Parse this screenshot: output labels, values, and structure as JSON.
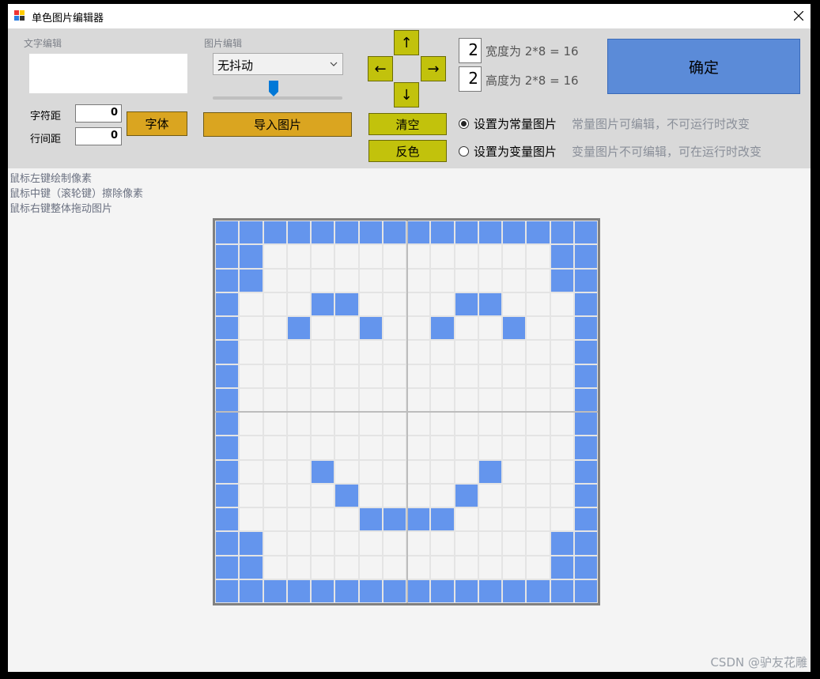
{
  "window": {
    "title": "单色图片编辑器"
  },
  "text_edit": {
    "label": "文字编辑",
    "value": ""
  },
  "char_spacing": {
    "label": "字符距",
    "value": "0"
  },
  "line_spacing": {
    "label": "行间距",
    "value": "0"
  },
  "font_button": "字体",
  "image_edit": {
    "label": "图片编辑",
    "dither_selected": "无抖动",
    "slider_level": 0.47
  },
  "import_button": "导入图片",
  "arrows": {
    "up": "↑",
    "down": "↓",
    "left": "←",
    "right": "→"
  },
  "clear_button": "清空",
  "invert_button": "反色",
  "size": {
    "width_value": "2",
    "width_label": "宽度为 2*8 = 16",
    "height_value": "2",
    "height_label": "高度为 2*8 = 16"
  },
  "confirm_button": "确定",
  "mode": {
    "selected": "constant",
    "constant_label": "设置为常量图片",
    "constant_hint": "常量图片可编辑，不可运行时改变",
    "variable_label": "设置为变量图片",
    "variable_hint": "变量图片不可编辑，可在运行时改变"
  },
  "hints": [
    "鼠标左键绘制像素",
    "鼠标中键（滚轮键）擦除像素",
    "鼠标右键整体拖动图片"
  ],
  "pixel_grid": {
    "size": 16,
    "on_color": "#6495ed",
    "rows": [
      "1111111111111111",
      "1100000000000011",
      "1100000000000011",
      "1000110000110001",
      "1001001001001001",
      "1000000000000001",
      "1000000000000001",
      "1000000000000001",
      "1000000000000001",
      "1000000000000001",
      "1000100000010001",
      "1000010000100001",
      "1000001111000001",
      "1100000000000011",
      "1100000000000011",
      "1111111111111111"
    ]
  },
  "watermark": "CSDN @驴友花雕"
}
